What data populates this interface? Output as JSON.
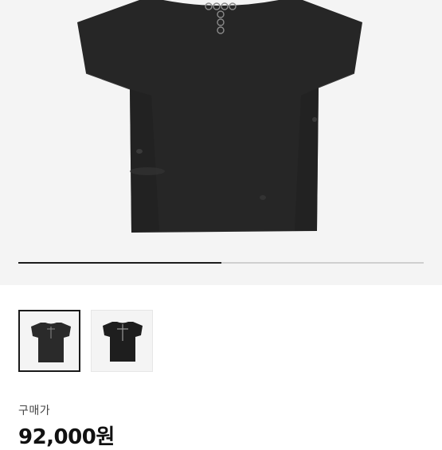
{
  "gallery": {
    "image_count": 2,
    "current_index": 1,
    "progress_fraction": 0.5,
    "thumbnails": [
      {
        "name": "thumbnail-1",
        "selected": true
      },
      {
        "name": "thumbnail-2",
        "selected": false
      }
    ]
  },
  "product": {
    "price_label": "구매가",
    "price": "92,000원"
  },
  "colors": {
    "shirt": "#2a2a2a",
    "hero_bg": "#f4f4f4",
    "progress_fill": "#1c1c1c",
    "progress_track": "#cfcfcf"
  }
}
